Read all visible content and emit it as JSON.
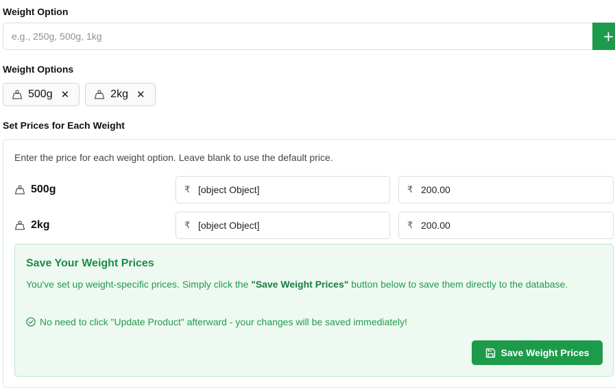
{
  "weight_option": {
    "label": "Weight Option",
    "input_value": "",
    "input_placeholder": "e.g., 250g, 500g, 1kg",
    "add_button_label": "+"
  },
  "weight_options": {
    "label": "Weight Options",
    "chips": [
      {
        "label": "500g",
        "icon": "weight-icon",
        "remove": "✕"
      },
      {
        "label": "2kg",
        "icon": "weight-icon",
        "remove": "✕"
      }
    ]
  },
  "prices": {
    "label": "Set Prices for Each Weight",
    "description": "Enter the price for each weight option. Leave blank to use the default price.",
    "currency_symbol": "₹",
    "rows": [
      {
        "weight": "500g",
        "price": "[object Object]",
        "default_price": "200.00"
      },
      {
        "weight": "2kg",
        "price": "[object Object]",
        "default_price": "200.00"
      }
    ]
  },
  "notice": {
    "title": "Save Your Weight Prices",
    "body_before": "You've set up weight-specific prices. Simply click the ",
    "body_strong": "\"Save Weight Prices\"",
    "body_after": " button below to save them directly to the database.",
    "note": "No need to click \"Update Product\" afterward - your changes will be saved immediately!",
    "save_button_label": "Save Weight Prices"
  },
  "colors": {
    "accent": "#1e9a4b",
    "notice_bg": "#eefaf1",
    "notice_text": "#22994d"
  }
}
